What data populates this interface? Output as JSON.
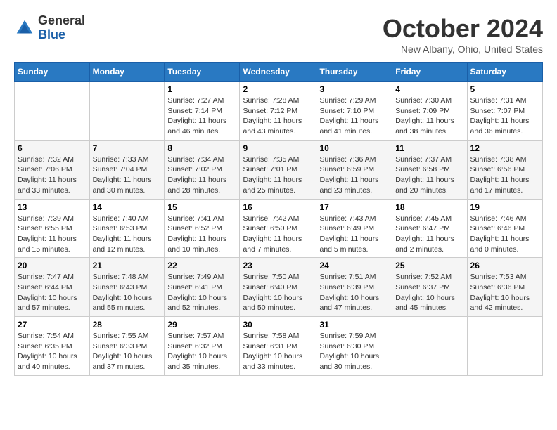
{
  "logo": {
    "general": "General",
    "blue": "Blue"
  },
  "title": "October 2024",
  "location": "New Albany, Ohio, United States",
  "days_of_week": [
    "Sunday",
    "Monday",
    "Tuesday",
    "Wednesday",
    "Thursday",
    "Friday",
    "Saturday"
  ],
  "weeks": [
    [
      {
        "day": "",
        "info": ""
      },
      {
        "day": "",
        "info": ""
      },
      {
        "day": "1",
        "info": "Sunrise: 7:27 AM\nSunset: 7:14 PM\nDaylight: 11 hours and 46 minutes."
      },
      {
        "day": "2",
        "info": "Sunrise: 7:28 AM\nSunset: 7:12 PM\nDaylight: 11 hours and 43 minutes."
      },
      {
        "day": "3",
        "info": "Sunrise: 7:29 AM\nSunset: 7:10 PM\nDaylight: 11 hours and 41 minutes."
      },
      {
        "day": "4",
        "info": "Sunrise: 7:30 AM\nSunset: 7:09 PM\nDaylight: 11 hours and 38 minutes."
      },
      {
        "day": "5",
        "info": "Sunrise: 7:31 AM\nSunset: 7:07 PM\nDaylight: 11 hours and 36 minutes."
      }
    ],
    [
      {
        "day": "6",
        "info": "Sunrise: 7:32 AM\nSunset: 7:06 PM\nDaylight: 11 hours and 33 minutes."
      },
      {
        "day": "7",
        "info": "Sunrise: 7:33 AM\nSunset: 7:04 PM\nDaylight: 11 hours and 30 minutes."
      },
      {
        "day": "8",
        "info": "Sunrise: 7:34 AM\nSunset: 7:02 PM\nDaylight: 11 hours and 28 minutes."
      },
      {
        "day": "9",
        "info": "Sunrise: 7:35 AM\nSunset: 7:01 PM\nDaylight: 11 hours and 25 minutes."
      },
      {
        "day": "10",
        "info": "Sunrise: 7:36 AM\nSunset: 6:59 PM\nDaylight: 11 hours and 23 minutes."
      },
      {
        "day": "11",
        "info": "Sunrise: 7:37 AM\nSunset: 6:58 PM\nDaylight: 11 hours and 20 minutes."
      },
      {
        "day": "12",
        "info": "Sunrise: 7:38 AM\nSunset: 6:56 PM\nDaylight: 11 hours and 17 minutes."
      }
    ],
    [
      {
        "day": "13",
        "info": "Sunrise: 7:39 AM\nSunset: 6:55 PM\nDaylight: 11 hours and 15 minutes."
      },
      {
        "day": "14",
        "info": "Sunrise: 7:40 AM\nSunset: 6:53 PM\nDaylight: 11 hours and 12 minutes."
      },
      {
        "day": "15",
        "info": "Sunrise: 7:41 AM\nSunset: 6:52 PM\nDaylight: 11 hours and 10 minutes."
      },
      {
        "day": "16",
        "info": "Sunrise: 7:42 AM\nSunset: 6:50 PM\nDaylight: 11 hours and 7 minutes."
      },
      {
        "day": "17",
        "info": "Sunrise: 7:43 AM\nSunset: 6:49 PM\nDaylight: 11 hours and 5 minutes."
      },
      {
        "day": "18",
        "info": "Sunrise: 7:45 AM\nSunset: 6:47 PM\nDaylight: 11 hours and 2 minutes."
      },
      {
        "day": "19",
        "info": "Sunrise: 7:46 AM\nSunset: 6:46 PM\nDaylight: 11 hours and 0 minutes."
      }
    ],
    [
      {
        "day": "20",
        "info": "Sunrise: 7:47 AM\nSunset: 6:44 PM\nDaylight: 10 hours and 57 minutes."
      },
      {
        "day": "21",
        "info": "Sunrise: 7:48 AM\nSunset: 6:43 PM\nDaylight: 10 hours and 55 minutes."
      },
      {
        "day": "22",
        "info": "Sunrise: 7:49 AM\nSunset: 6:41 PM\nDaylight: 10 hours and 52 minutes."
      },
      {
        "day": "23",
        "info": "Sunrise: 7:50 AM\nSunset: 6:40 PM\nDaylight: 10 hours and 50 minutes."
      },
      {
        "day": "24",
        "info": "Sunrise: 7:51 AM\nSunset: 6:39 PM\nDaylight: 10 hours and 47 minutes."
      },
      {
        "day": "25",
        "info": "Sunrise: 7:52 AM\nSunset: 6:37 PM\nDaylight: 10 hours and 45 minutes."
      },
      {
        "day": "26",
        "info": "Sunrise: 7:53 AM\nSunset: 6:36 PM\nDaylight: 10 hours and 42 minutes."
      }
    ],
    [
      {
        "day": "27",
        "info": "Sunrise: 7:54 AM\nSunset: 6:35 PM\nDaylight: 10 hours and 40 minutes."
      },
      {
        "day": "28",
        "info": "Sunrise: 7:55 AM\nSunset: 6:33 PM\nDaylight: 10 hours and 37 minutes."
      },
      {
        "day": "29",
        "info": "Sunrise: 7:57 AM\nSunset: 6:32 PM\nDaylight: 10 hours and 35 minutes."
      },
      {
        "day": "30",
        "info": "Sunrise: 7:58 AM\nSunset: 6:31 PM\nDaylight: 10 hours and 33 minutes."
      },
      {
        "day": "31",
        "info": "Sunrise: 7:59 AM\nSunset: 6:30 PM\nDaylight: 10 hours and 30 minutes."
      },
      {
        "day": "",
        "info": ""
      },
      {
        "day": "",
        "info": ""
      }
    ]
  ]
}
